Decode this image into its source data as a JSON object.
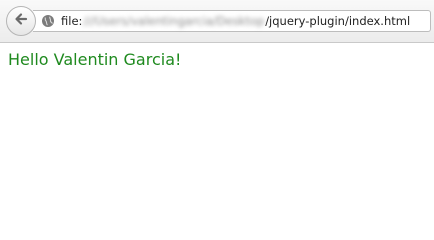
{
  "browser": {
    "url_prefix": "file:",
    "url_obscured": "///Users/valentingarcia/Desktop",
    "url_suffix": "/jquery-plugin/index.html"
  },
  "page": {
    "greeting": "Hello Valentin Garcia!",
    "greeting_color": "#1f8a1f"
  },
  "icons": {
    "back": "back-arrow-icon",
    "site": "globe-icon"
  }
}
